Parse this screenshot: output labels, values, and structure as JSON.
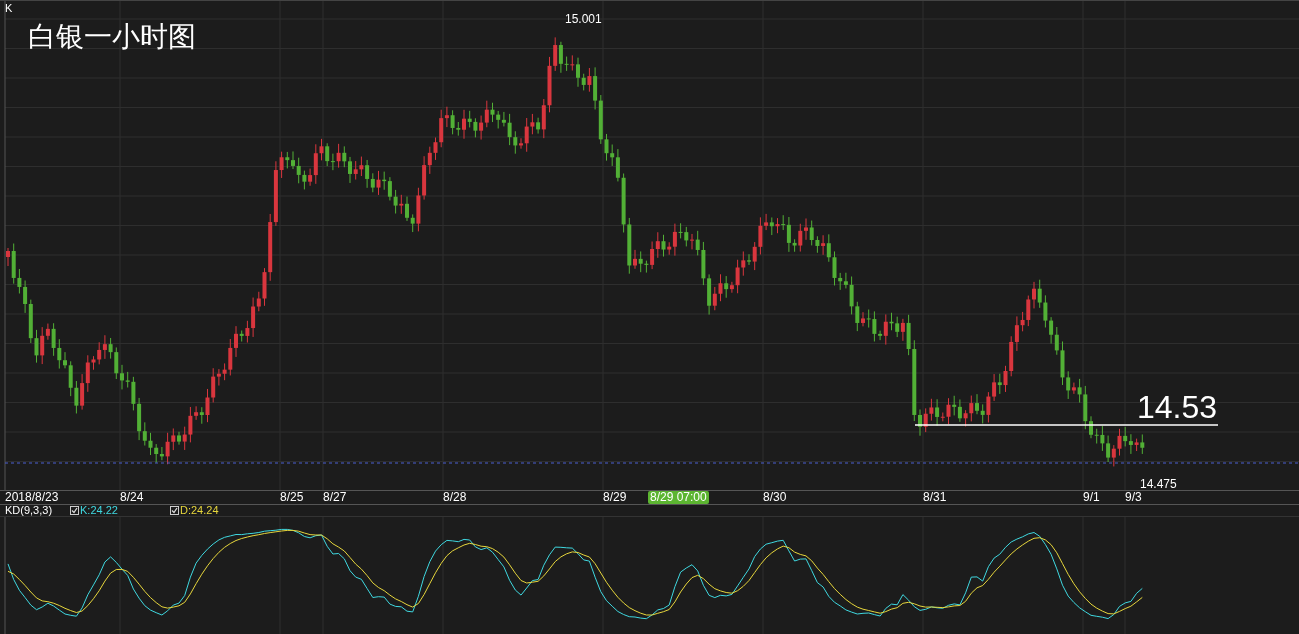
{
  "panel_label": "K",
  "title": "白银一小时图",
  "price_labels": [
    {
      "kind": "high",
      "text": "15.001"
    },
    {
      "kind": "level",
      "text": "14.53"
    },
    {
      "kind": "low",
      "text": "14.475"
    }
  ],
  "time_axis": [
    {
      "kind": "date",
      "text": "2018/8/23"
    },
    {
      "kind": "date",
      "text": "8/24"
    },
    {
      "kind": "date",
      "text": "8/25"
    },
    {
      "kind": "date",
      "text": "8/27"
    },
    {
      "kind": "date",
      "text": "8/28"
    },
    {
      "kind": "date",
      "text": "8/29"
    },
    {
      "kind": "cursor",
      "text": "8/29 07:00"
    },
    {
      "kind": "date",
      "text": "8/30"
    },
    {
      "kind": "date",
      "text": "8/31"
    },
    {
      "kind": "date",
      "text": "9/1"
    },
    {
      "kind": "date",
      "text": "9/3"
    }
  ],
  "indicator": {
    "name": "KD(9,3,3)",
    "lines": [
      {
        "text": "K:24.22",
        "checked": true,
        "color": "#3fd8e0"
      },
      {
        "text": "D:24.24",
        "checked": true,
        "color": "#e6d63c"
      }
    ]
  }
}
